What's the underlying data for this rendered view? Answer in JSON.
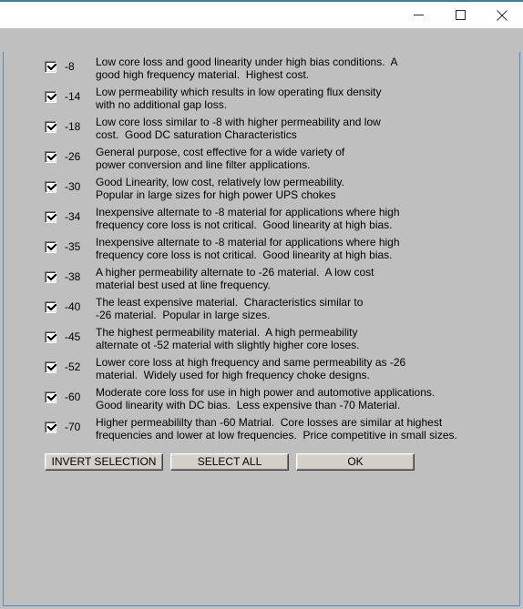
{
  "window": {
    "title": "",
    "controls": {
      "minimize_label": "Minimize",
      "maximize_label": "Maximize",
      "close_label": "Close"
    },
    "accent_color": "#4a90c4",
    "titlebar_top_border_color": "#3b7f9e",
    "client_background": "#bfbfbf"
  },
  "materials": [
    {
      "code": "-8",
      "checked": true,
      "line1": "Low core loss and good linearity under high bias conditions.  A",
      "line2": "good high frequency material.  Highest cost."
    },
    {
      "code": "-14",
      "checked": true,
      "line1": "Low permeability which results in low operating flux density",
      "line2": "with no additional gap loss."
    },
    {
      "code": "-18",
      "checked": true,
      "line1": "Low core loss similar to -8 with higher permeability and low",
      "line2": "cost.  Good DC saturation Characteristics"
    },
    {
      "code": "-26",
      "checked": true,
      "line1": "General purpose, cost effective for a wide variety of",
      "line2": "power conversion and line filter applications."
    },
    {
      "code": "-30",
      "checked": true,
      "line1": "Good Linearity, low cost, relatively low permeability.",
      "line2": "Popular in large sizes for high power UPS chokes"
    },
    {
      "code": "-34",
      "checked": true,
      "line1": "Inexpensive alternate to -8 material for applications where high",
      "line2": "frequency core loss is not critical.  Good linearity at high bias."
    },
    {
      "code": "-35",
      "checked": true,
      "line1": "Inexpensive alternate to -8 material for applications where high",
      "line2": "frequency core loss is not critical.  Good linearity at high bias."
    },
    {
      "code": "-38",
      "checked": true,
      "line1": "A higher permeability alternate to -26 material.  A low cost",
      "line2": "material best used at line frequency."
    },
    {
      "code": "-40",
      "checked": true,
      "line1": "The least expensive material.  Characteristics similar to",
      "line2": "-26 material.  Popular in large sizes."
    },
    {
      "code": "-45",
      "checked": true,
      "line1": "The highest permeability material.  A high permeability",
      "line2": "alternate ot -52 material with slightly higher core loses."
    },
    {
      "code": "-52",
      "checked": true,
      "line1": "Lower core loss at high frequency and same permeability as -26",
      "line2": "material.  Widely used for high frequency choke designs."
    },
    {
      "code": "-60",
      "checked": true,
      "line1": "Moderate core loss for use in high power and automotive applications.",
      "line2": "Good linearity with DC bias.  Less expensive than -70 Material."
    },
    {
      "code": "-70",
      "checked": true,
      "line1": "Higher permeabililty than -60 Matrial.  Core losses are similar at highest",
      "line2": "frequencies and lower at low frequencies.  Price competitive in small sizes."
    }
  ],
  "buttons": {
    "invert_selection": "INVERT SELECTION",
    "select_all": "SELECT ALL",
    "ok": "OK"
  }
}
